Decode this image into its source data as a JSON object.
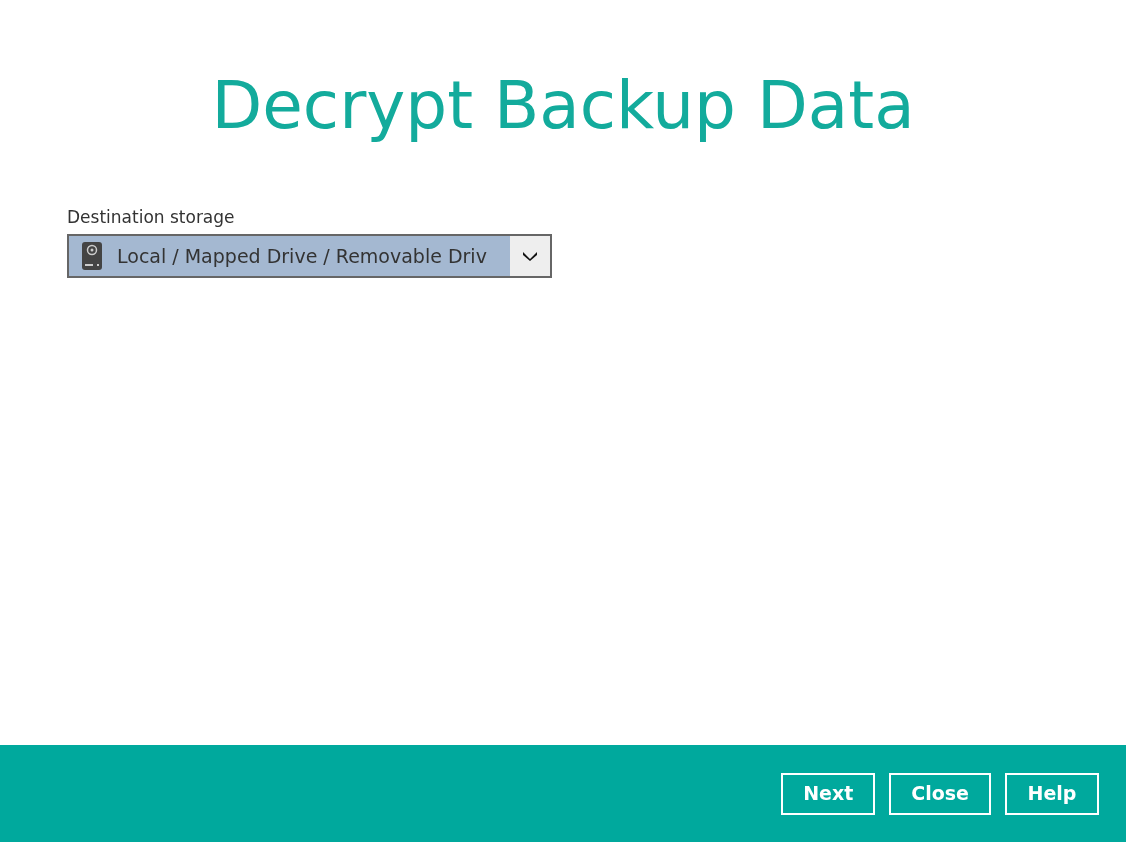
{
  "title": "Decrypt Backup Data",
  "destination": {
    "label": "Destination storage",
    "value": "Local / Mapped Drive / Removable Driv"
  },
  "buttons": [
    "Next",
    "Close",
    "Help"
  ]
}
